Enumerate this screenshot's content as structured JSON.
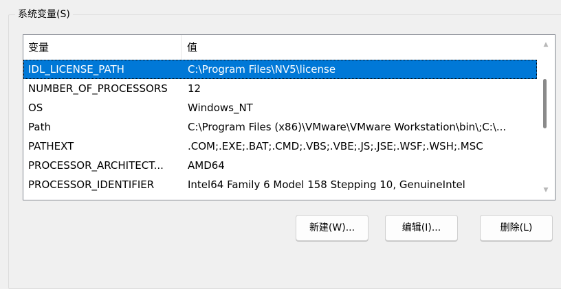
{
  "group": {
    "title": "系统变量(S)"
  },
  "list": {
    "headers": {
      "variable": "变量",
      "value": "值"
    },
    "rows": [
      {
        "name": "IDL_LICENSE_PATH",
        "value": "C:\\Program Files\\NV5\\license",
        "selected": true
      },
      {
        "name": "NUMBER_OF_PROCESSORS",
        "value": "12"
      },
      {
        "name": "OS",
        "value": "Windows_NT"
      },
      {
        "name": "Path",
        "value": "C:\\Program Files (x86)\\VMware\\VMware Workstation\\bin\\;C:\\..."
      },
      {
        "name": "PATHEXT",
        "value": ".COM;.EXE;.BAT;.CMD;.VBS;.VBE;.JS;.JSE;.WSF;.WSH;.MSC"
      },
      {
        "name": "PROCESSOR_ARCHITECT...",
        "value": "AMD64"
      },
      {
        "name": "PROCESSOR_IDENTIFIER",
        "value": "Intel64 Family 6 Model 158 Stepping 10, GenuineIntel"
      }
    ]
  },
  "buttons": {
    "new": "新建(W)...",
    "edit": "编辑(I)...",
    "delete": "删除(L)"
  },
  "colors": {
    "selection": "#0078d7",
    "background": "#f0f0f0"
  }
}
